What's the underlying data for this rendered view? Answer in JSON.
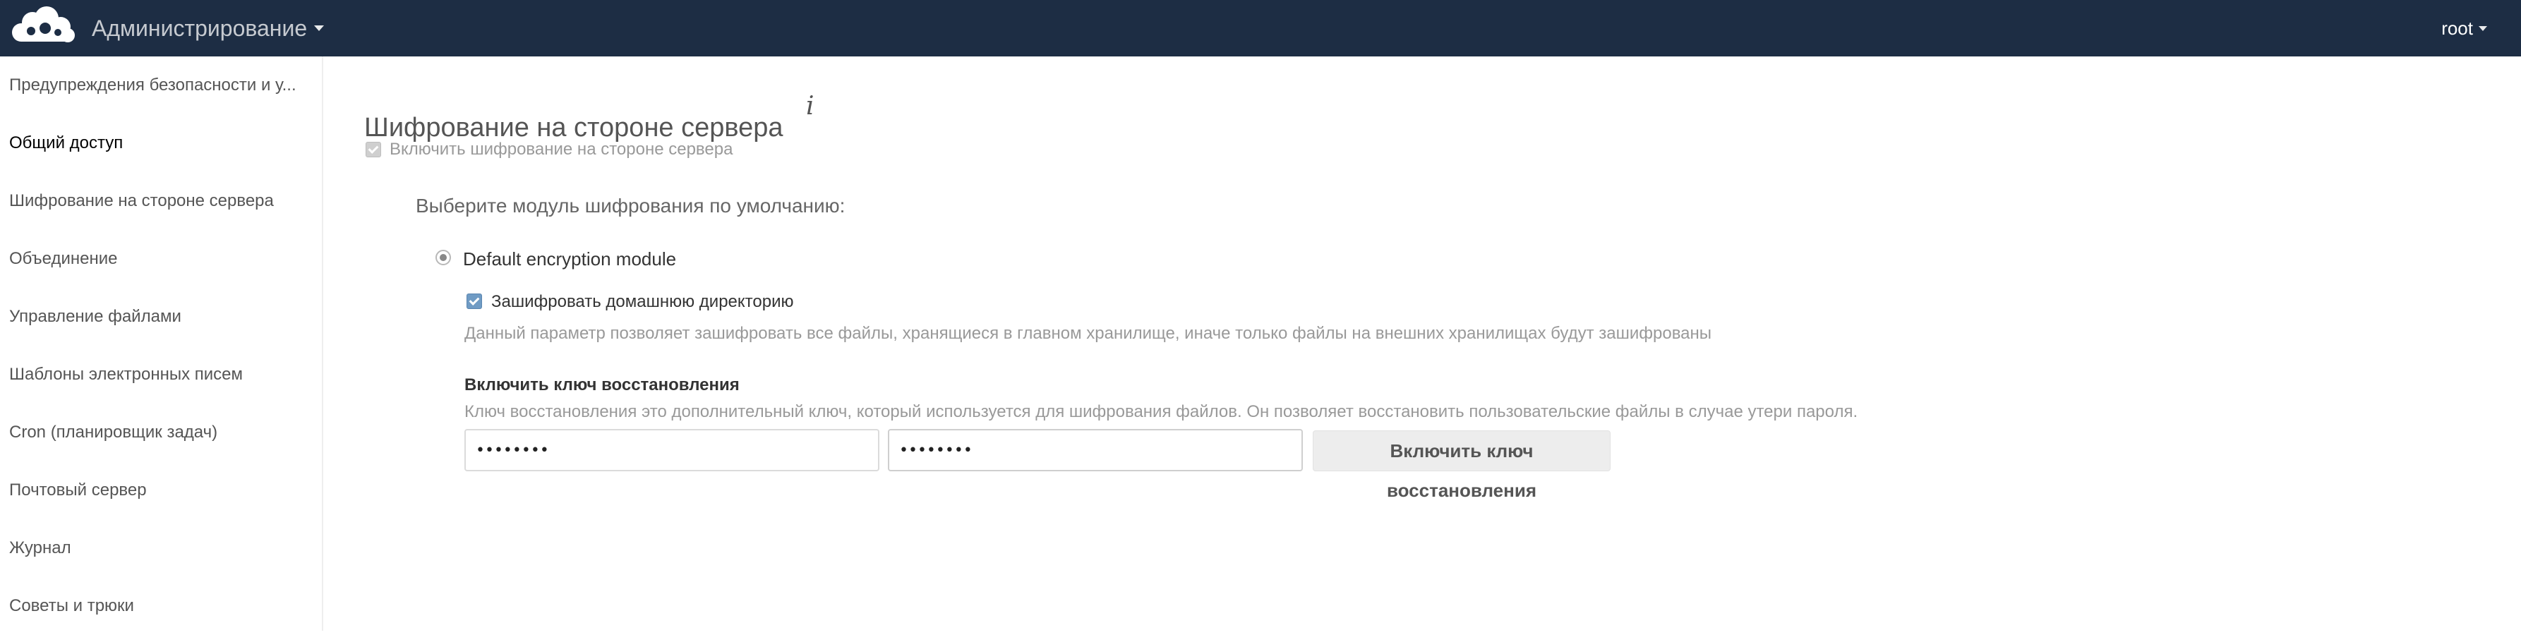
{
  "header": {
    "app_title": "Администрирование",
    "user_name": "root",
    "background_color": "#1d2d44"
  },
  "sidebar": {
    "items": [
      {
        "label": "Предупреждения безопасности и у...",
        "active": false
      },
      {
        "label": "Общий доступ",
        "active": true
      },
      {
        "label": "Шифрование на стороне сервера",
        "active": false
      },
      {
        "label": "Объединение",
        "active": false
      },
      {
        "label": "Управление файлами",
        "active": false
      },
      {
        "label": "Шаблоны электронных писем",
        "active": false
      },
      {
        "label": "Cron (планировщик задач)",
        "active": false
      },
      {
        "label": "Почтовый сервер",
        "active": false
      },
      {
        "label": "Журнал",
        "active": false
      },
      {
        "label": "Советы и трюки",
        "active": false
      }
    ]
  },
  "encryption": {
    "title": "Шифрование на стороне сервера",
    "info_icon": "i",
    "enable_label": "Включить шифрование на стороне сервера",
    "enable_checked": true,
    "module_prompt": "Выберите модуль шифрования по умолчанию:",
    "module_name": "Default encryption module",
    "module_selected": true,
    "home_storage": {
      "label": "Зашифровать домашнюю директорию",
      "checked": true,
      "hint": "Данный параметр позволяет зашифровать все файлы, хранящиеся в главном хранилище, иначе только файлы на внешних хранилищах будут зашифрованы"
    },
    "recovery": {
      "heading": "Включить ключ восстановления",
      "description": "Ключ восстановления это дополнительный ключ, который используется для шифрования файлов. Он позволяет восстановить пользовательские файлы в случае утери пароля.",
      "password_value": "••••••••",
      "confirm_value": "••••••••",
      "button_label": "Включить ключ восстановления"
    }
  }
}
